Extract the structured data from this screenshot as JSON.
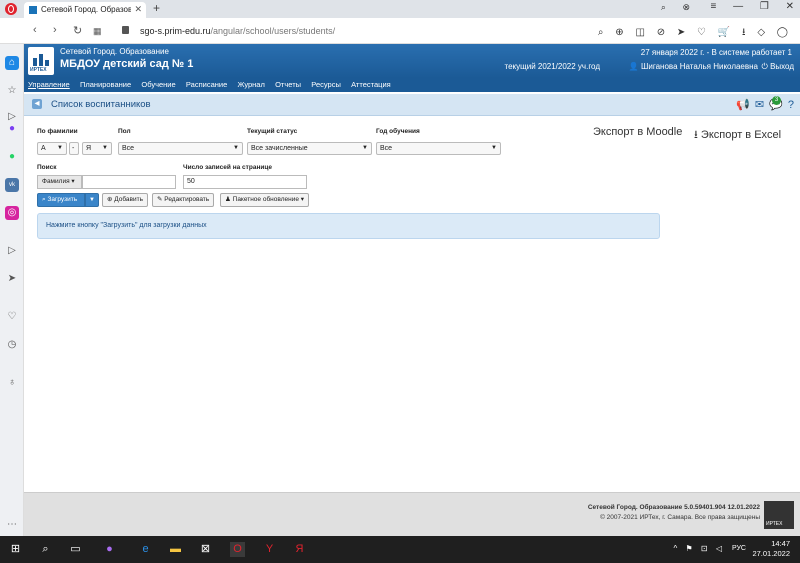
{
  "browser": {
    "tab_title": "Сетевой Город. Образование",
    "url_host": "sgo-s.prim-edu.ru",
    "url_path": "/angular/school/users/students/"
  },
  "header": {
    "app_name": "Сетевой Город. Образование",
    "org_name": "МБДОУ детский сад № 1",
    "date_info": "27 января 2022 г. - В системе работает 1",
    "school_year": "текущий 2021/2022 уч.год",
    "user_name": "Шиганова Наталья Николаевна",
    "exit_label": "Выход",
    "logo_text": "ИРТЕХ"
  },
  "menu": {
    "items": [
      {
        "label": "Управление"
      },
      {
        "label": "Планирование"
      },
      {
        "label": "Обучение"
      },
      {
        "label": "Расписание"
      },
      {
        "label": "Журнал"
      },
      {
        "label": "Отчеты"
      },
      {
        "label": "Ресурсы"
      },
      {
        "label": "Аттестация"
      }
    ]
  },
  "titlebar": {
    "title": "Список воспитанников",
    "badge_count": "3"
  },
  "filters": {
    "by_surname_label": "По фамилии",
    "surname_from": "А",
    "surname_sep": "-",
    "surname_to": "Я",
    "gender_label": "Пол",
    "gender_value": "Все",
    "status_label": "Текущий статус",
    "status_value": "Все зачисленные",
    "year_label": "Год обучения",
    "year_value": "Все",
    "search_label": "Поиск",
    "search_prefix": "Фамилия",
    "search_value": "",
    "per_page_label": "Число записей на странице",
    "per_page_value": "50"
  },
  "export": {
    "moodle": "Экспорт в Moodle",
    "excel": "Экспорт в Excel"
  },
  "buttons": {
    "load": "Загрузить",
    "add": "Добавить",
    "edit": "Редактировать",
    "batch": "Пакетное обновление"
  },
  "info_message": "Нажмите кнопку \"Загрузить\" для загрузки данных",
  "footer": {
    "version": "Сетевой Город. Образование  5.0.59401.904  12.01.2022",
    "copyright": "© 2007-2021 ИРТех, г. Самара. Все права защищены",
    "logo_text": "ИРТЕХ"
  },
  "taskbar": {
    "lang": "РУС",
    "time": "14:47",
    "date": "27.01.2022"
  },
  "colors": {
    "header_blue": "#1b5a96",
    "titlebar_bg": "#d5e5f3",
    "primary_button": "#3a85c9",
    "info_bg": "#dbeaf7"
  }
}
